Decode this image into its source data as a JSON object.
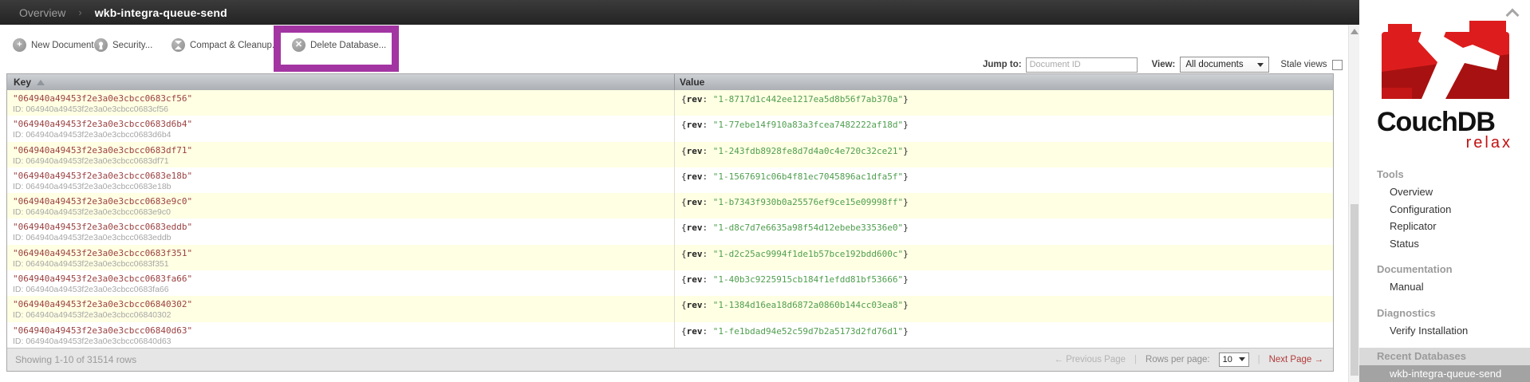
{
  "header": {
    "breadcrumb_root": "Overview",
    "breadcrumb_separator": "›",
    "db_name": "wkb-integra-queue-send"
  },
  "toolbar": {
    "buttons": [
      {
        "label": "New Document",
        "icon": "plus-circle-icon"
      },
      {
        "label": "Security...",
        "icon": "lock-circle-icon"
      },
      {
        "label": "Compact & Cleanup...",
        "icon": "compact-circle-icon"
      },
      {
        "label": "Delete Database...",
        "icon": "delete-circle-icon",
        "highlighted": true
      }
    ],
    "jump_to_label": "Jump to:",
    "jump_to_placeholder": "Document ID",
    "view_label": "View:",
    "view_value": "All documents",
    "stale_views_label": "Stale views",
    "stale_views_checked": false
  },
  "table": {
    "key_header": "Key",
    "value_header": "Value",
    "value_open": "{",
    "value_field": "rev",
    "value_colon": ": ",
    "value_close": "}",
    "rows": [
      {
        "key": "\"064940a49453f2e3a0e3cbcc0683cf56\"",
        "id": "ID: 064940a49453f2e3a0e3cbcc0683cf56",
        "rev": "\"1-8717d1c442ee1217ea5d8b56f7ab370a\""
      },
      {
        "key": "\"064940a49453f2e3a0e3cbcc0683d6b4\"",
        "id": "ID: 064940a49453f2e3a0e3cbcc0683d6b4",
        "rev": "\"1-77ebe14f910a83a3fcea7482222af18d\""
      },
      {
        "key": "\"064940a49453f2e3a0e3cbcc0683df71\"",
        "id": "ID: 064940a49453f2e3a0e3cbcc0683df71",
        "rev": "\"1-243fdb8928fe8d7d4a0c4e720c32ce21\""
      },
      {
        "key": "\"064940a49453f2e3a0e3cbcc0683e18b\"",
        "id": "ID: 064940a49453f2e3a0e3cbcc0683e18b",
        "rev": "\"1-1567691c06b4f81ec7045896ac1dfa5f\""
      },
      {
        "key": "\"064940a49453f2e3a0e3cbcc0683e9c0\"",
        "id": "ID: 064940a49453f2e3a0e3cbcc0683e9c0",
        "rev": "\"1-b7343f930b0a25576ef9ce15e09998ff\""
      },
      {
        "key": "\"064940a49453f2e3a0e3cbcc0683eddb\"",
        "id": "ID: 064940a49453f2e3a0e3cbcc0683eddb",
        "rev": "\"1-d8c7d7e6635a98f54d12ebebe33536e0\""
      },
      {
        "key": "\"064940a49453f2e3a0e3cbcc0683f351\"",
        "id": "ID: 064940a49453f2e3a0e3cbcc0683f351",
        "rev": "\"1-d2c25ac9994f1de1b57bce192bdd600c\""
      },
      {
        "key": "\"064940a49453f2e3a0e3cbcc0683fa66\"",
        "id": "ID: 064940a49453f2e3a0e3cbcc0683fa66",
        "rev": "\"1-40b3c9225915cb184f1efdd81bf53666\""
      },
      {
        "key": "\"064940a49453f2e3a0e3cbcc06840302\"",
        "id": "ID: 064940a49453f2e3a0e3cbcc06840302",
        "rev": "\"1-1384d16ea18d6872a0860b144cc03ea8\""
      },
      {
        "key": "\"064940a49453f2e3a0e3cbcc06840d63\"",
        "id": "ID: 064940a49453f2e3a0e3cbcc06840d63",
        "rev": "\"1-fe1bdad94e52c59d7b2a5173d2fd76d1\""
      }
    ]
  },
  "footer": {
    "showing": "Showing 1-10 of 31514 rows",
    "previous_label": "← Previous Page",
    "separator": "|",
    "rows_per_page_label": "Rows per page:",
    "rows_per_page_value": "10",
    "next_label": "Next Page →"
  },
  "sidebar": {
    "logo_title": "CouchDB",
    "logo_tagline": "relax",
    "sections": [
      {
        "title": "Tools",
        "items": [
          "Overview",
          "Configuration",
          "Replicator",
          "Status"
        ]
      },
      {
        "title": "Documentation",
        "items": [
          "Manual"
        ]
      },
      {
        "title": "Diagnostics",
        "items": [
          "Verify Installation"
        ]
      },
      {
        "title": "Recent Databases",
        "items": [
          "wkb-integra-queue-send"
        ],
        "selected_item": "wkb-integra-queue-send"
      }
    ]
  },
  "colors": {
    "highlight_purple": "#a335a2",
    "couch_red": "#dd1d1d",
    "key_red": "#9c4141",
    "value_green": "#4f9e4f",
    "next_page_red": "#b23b3b"
  }
}
